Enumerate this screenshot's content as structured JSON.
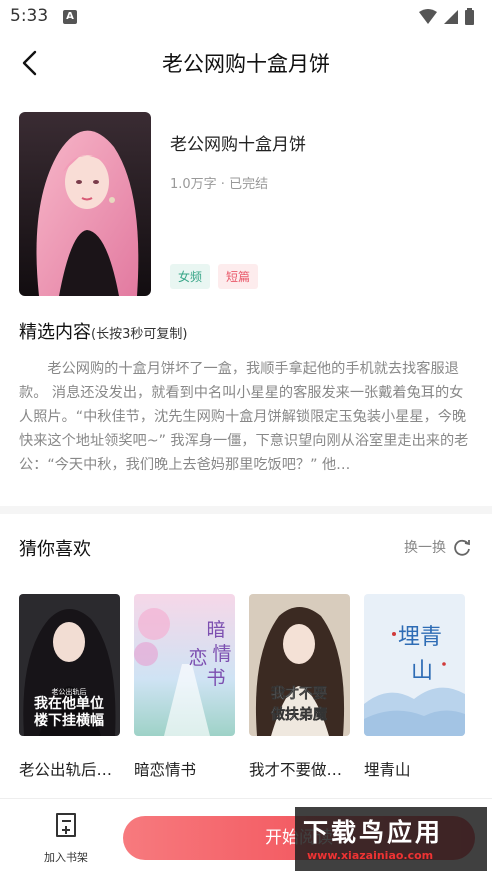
{
  "status": {
    "time": "5:33",
    "a_badge": "A"
  },
  "header": {
    "title": "老公网购十盒月饼"
  },
  "book": {
    "title": "老公网购十盒月饼",
    "meta": "1.0万字 · 已完结",
    "tags": [
      "女频",
      "短篇"
    ]
  },
  "excerpt": {
    "heading": "精选内容",
    "hint": "(长按3秒可复制)",
    "text": "老公网购的十盒月饼坏了一盒，我顺手拿起他的手机就去找客服退款。    消息还没发出，就看到中名叫小星星的客服发来一张戴着兔耳的女人照片。“中秋佳节，沈先生网购十盒月饼解锁限定玉兔装小星星，今晚快来这个地址领奖吧~”  我浑身一僵，下意识望向刚从浴室里走出来的老公：“今天中秋，我们晚上去爸妈那里吃饭吧？”  他…"
  },
  "recommend": {
    "heading": "猜你喜欢",
    "refresh_label": "换一换",
    "items": [
      {
        "title": "老公出轨后我在他单位楼下挂横幅",
        "cover_text": "我在他单位楼下挂横幅",
        "cover_top": "老公出轨后"
      },
      {
        "title": "暗恋情书",
        "cover_text": "暗情恋书"
      },
      {
        "title": "我才不要做扶弟魔",
        "cover_text": "我才不要做扶弟魔"
      },
      {
        "title": "埋青山",
        "cover_text": "埋青山"
      }
    ]
  },
  "bottom": {
    "shelf_label": "加入书架",
    "read_label": "开始阅读"
  },
  "watermark": {
    "big": "下载鸟应用",
    "small": "www.xiazainiao.com"
  }
}
